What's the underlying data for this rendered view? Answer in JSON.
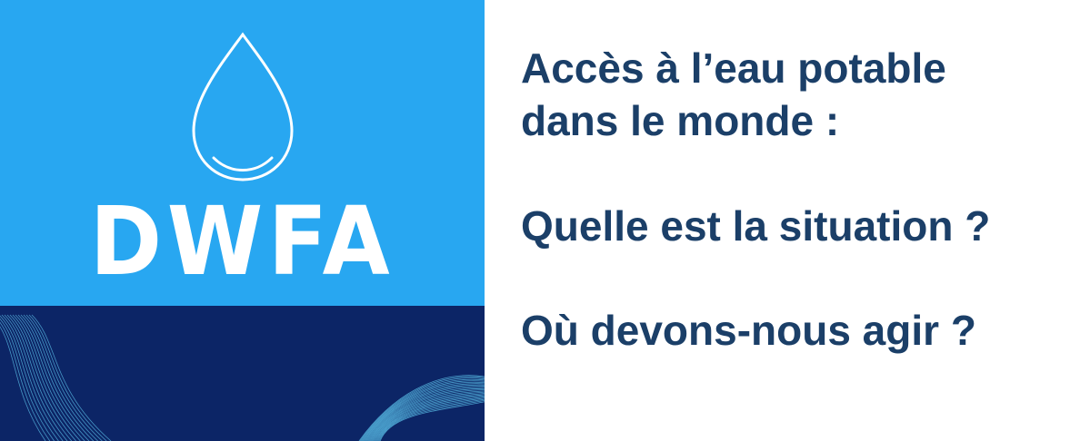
{
  "logo": {
    "icon": "water-drop-icon",
    "text": "DWFA"
  },
  "headline": {
    "title_line_1": "Accès à l’eau potable",
    "title_line_2": "dans le monde  :",
    "question_1": "Quelle est la situation ?",
    "question_2": "Où devons-nous agir ?"
  },
  "colors": {
    "brand_blue": "#28a7f1",
    "navy": "#0c2566",
    "text": "#1b3f68",
    "wave": "#5fc8ef"
  }
}
